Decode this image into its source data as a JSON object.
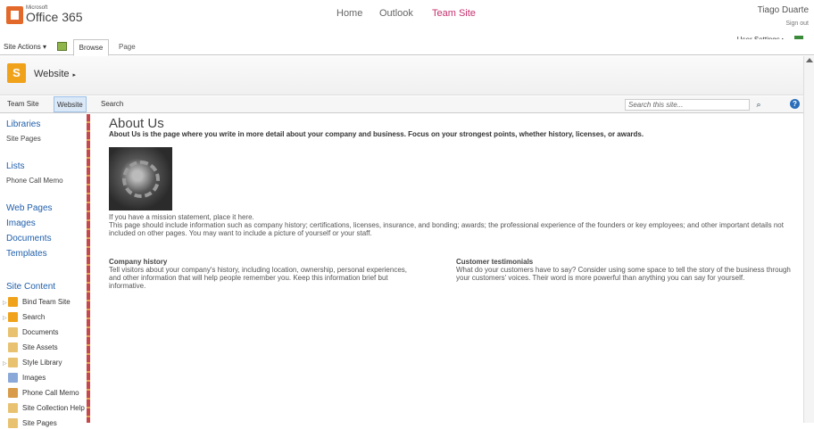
{
  "suite_bar": {
    "logo_small": "Microsoft",
    "logo_text": "Office 365",
    "nav": [
      "Home",
      "Outlook",
      "Team Site"
    ],
    "selected": "Team Site",
    "user": "Tiago Duarte",
    "signout": "Sign out"
  },
  "ribbon": {
    "site_actions": "Site Actions ▾",
    "tabs": [
      "Browse",
      "Page"
    ],
    "user_settings": "User Settings ▸"
  },
  "title_area": {
    "site_title": "Website",
    "arrow": "▸"
  },
  "top_nav": {
    "links": [
      "Team Site",
      "Website",
      "Search"
    ],
    "search_placeholder": "Search this site...",
    "help": "?"
  },
  "left_nav": {
    "libraries_head": "Libraries",
    "libraries": [
      "Site Pages"
    ],
    "lists_head": "Lists",
    "lists": [
      "Phone Call Memo"
    ],
    "web_pages_head": "Web Pages",
    "pages_links": [
      "Images",
      "Documents",
      "Templates"
    ],
    "site_content_head": "Site Content",
    "site_content": [
      "Bind Team Site",
      "Search",
      "Documents",
      "Site Assets",
      "Style Library",
      "Images",
      "Phone Call Memo",
      "Site Collection Help",
      "Site Pages"
    ]
  },
  "content": {
    "title": "About Us",
    "intro": "About Us is the page where you write in more detail about your company and business. Focus on your strongest points, whether history, licenses, or awards.",
    "mission_line1": "If you have a mission statement, place it here.",
    "mission_line2": "This page should include information such as company history; certifications, licenses, insurance, and bonding; awards; the professional experience of the founders or key employees; and other important details not included on other pages. You may want to include a picture of yourself or your staff.",
    "history_head": "Company history",
    "history_text": "Tell visitors about your company's history, including location, ownership, personal experiences, and other information that will help people remember you. Keep this information brief but informative.",
    "testimonials_head": "Customer testimonials",
    "testimonials_text": "What do your customers have to say? Consider using some space to tell the story of the business through your customers' voices. Their word is more powerful than anything you can say for yourself."
  },
  "colors": {
    "accent": "#c4326d",
    "link": "#1f5fab",
    "site_logo": "#f0a21b",
    "office_logo": "#e3692a"
  }
}
